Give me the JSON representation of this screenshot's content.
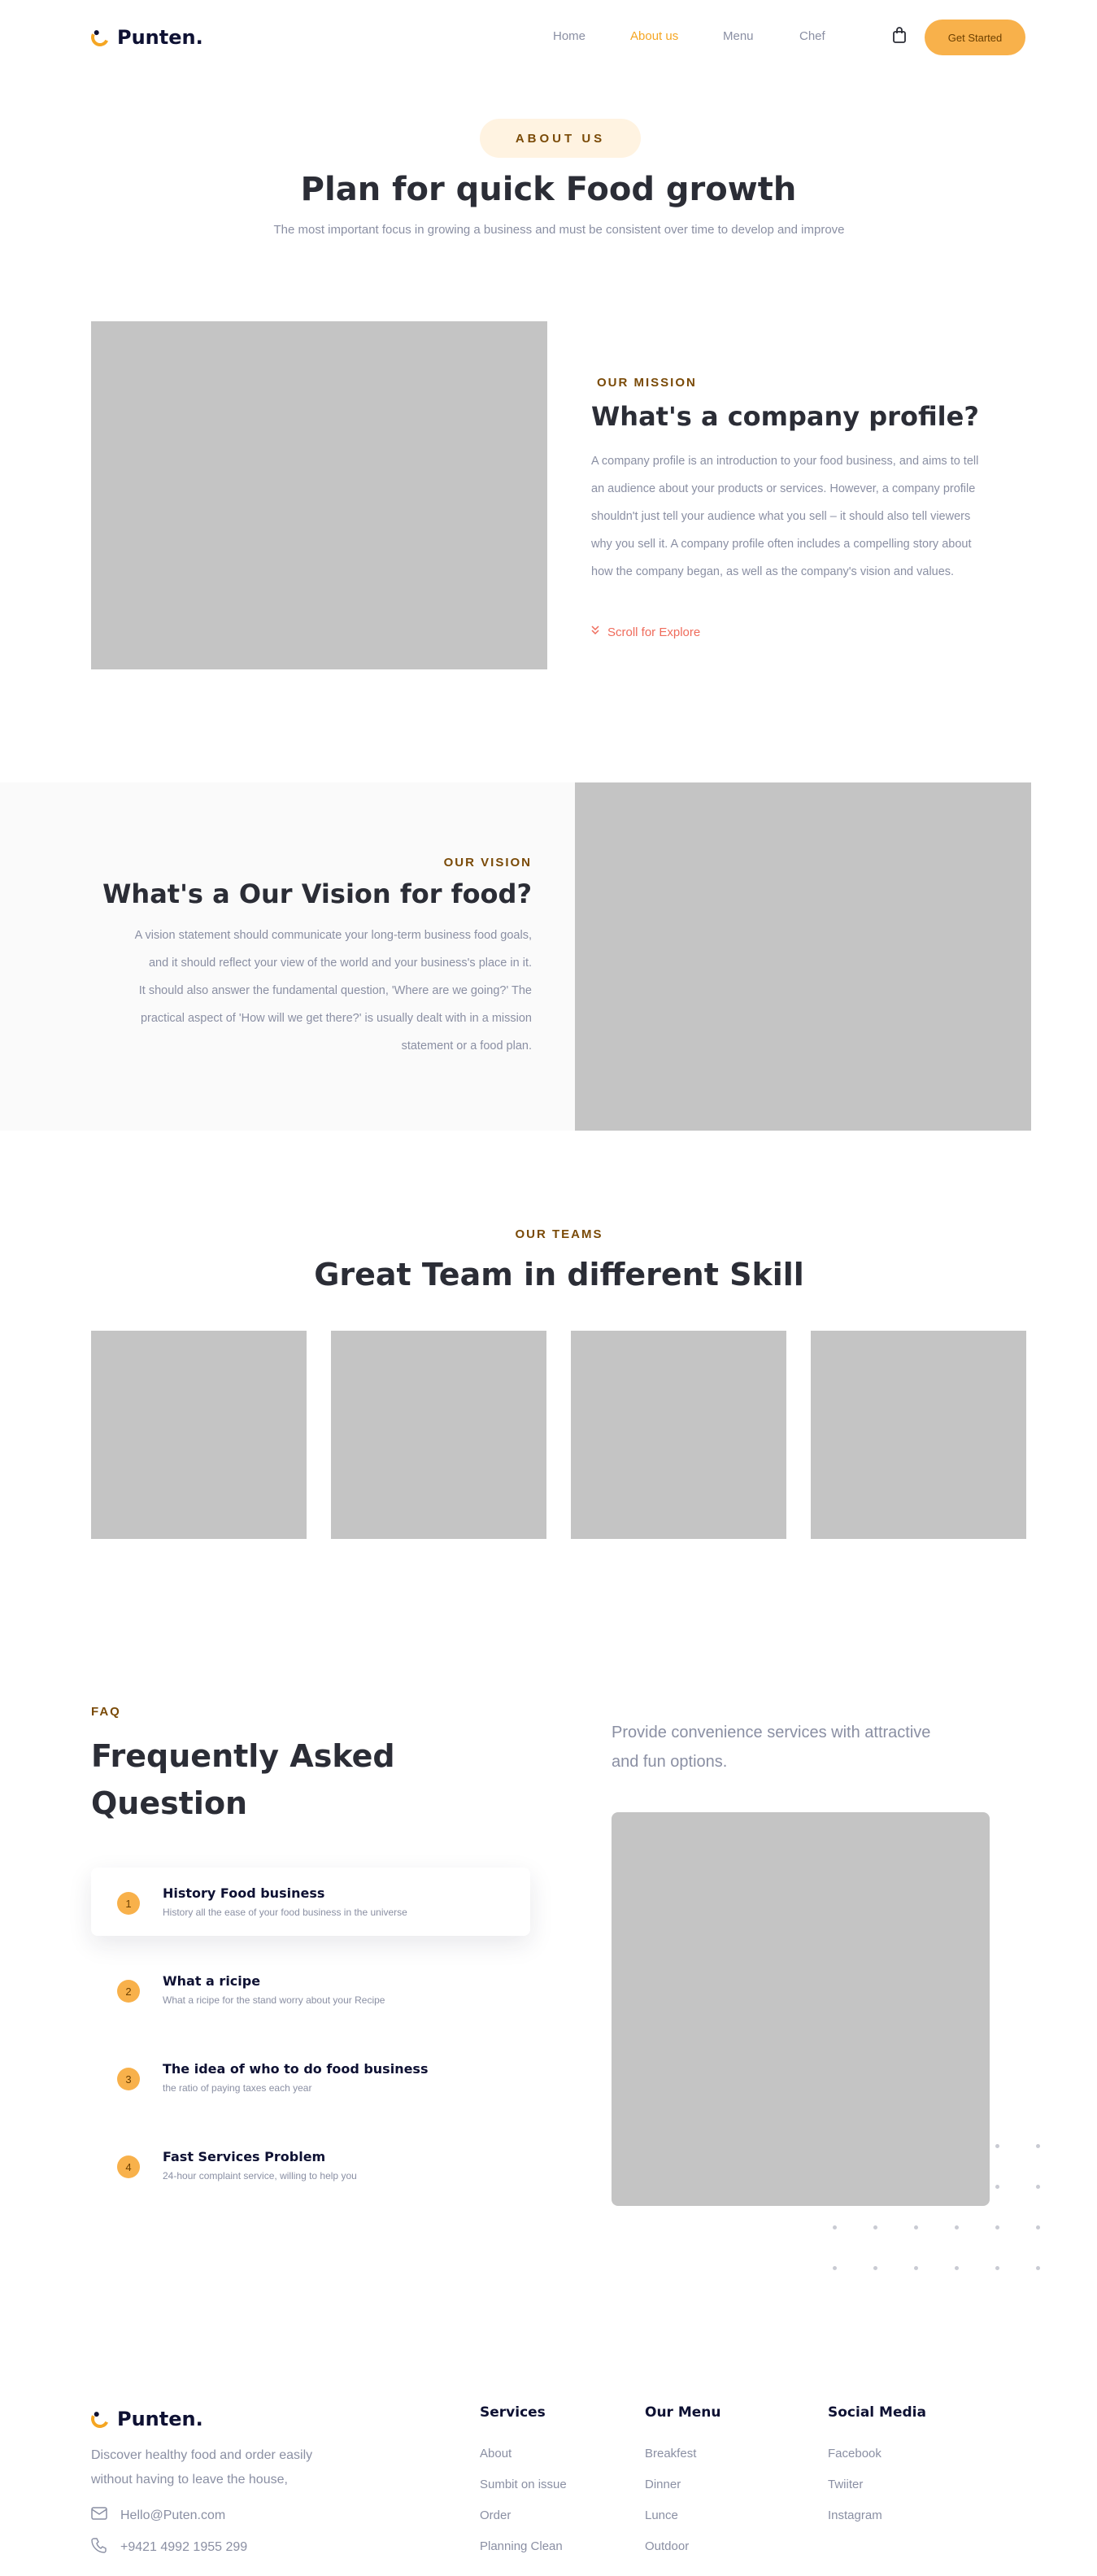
{
  "brand": {
    "name": "Punten."
  },
  "nav": {
    "items": [
      {
        "label": "Home",
        "active": false
      },
      {
        "label": "About us",
        "active": true
      },
      {
        "label": "Menu",
        "active": false
      },
      {
        "label": "Chef",
        "active": false
      }
    ],
    "cta": "Get Started"
  },
  "hero": {
    "pill": "ABOUT US",
    "title": "Plan for quick Food growth",
    "subtitle": "The most important focus in growing a business and must be consistent over time to develop and improve"
  },
  "mission": {
    "eyebrow": "OUR MISSION",
    "title": "What's a company profile?",
    "lines": [
      "A company profile is an introduction to your food business, and aims to tell",
      "an audience about your products or services. However, a company profile",
      "shouldn't just tell your audience what you sell – it should also tell viewers",
      "why you sell it. A company profile often includes a compelling story about",
      "how the company began, as well as the company's vision and values."
    ],
    "scroll": "Scroll for Explore"
  },
  "vision": {
    "eyebrow": "OUR VISION",
    "title": "What's a Our Vision for food?",
    "lines": [
      "A vision statement should communicate your long-term business food goals,",
      "and it should reflect your view of the world and your business's place in it.",
      "It should also answer the fundamental question, 'Where are we going?' The",
      "practical aspect of 'How will we get there?' is usually dealt with in a mission",
      "statement or a food plan."
    ]
  },
  "teams": {
    "eyebrow": "OUR TEAMS",
    "title": "Great Team in different Skill"
  },
  "faq": {
    "eyebrow": "FAQ",
    "title_line1": "Frequently Asked",
    "title_line2": "Question",
    "side_line1": "Provide convenience services with attractive",
    "side_line2": "and fun options.",
    "items": [
      {
        "num": "1",
        "title": "History Food business",
        "desc": "History all the ease of your food business in the universe"
      },
      {
        "num": "2",
        "title": "What a ricipe",
        "desc": "What a ricipe for the stand worry about your Recipe"
      },
      {
        "num": "3",
        "title": "The idea of who to do food business",
        "desc": "the ratio of paying taxes each year"
      },
      {
        "num": "4",
        "title": "Fast Services Problem",
        "desc": "24-hour complaint service, willing to help you"
      }
    ]
  },
  "footer": {
    "tagline_line1": "Discover healthy food and order easily",
    "tagline_line2": "without having to leave the house,",
    "email": "Hello@Puten.com",
    "phone": "+9421 4992 1955 299",
    "columns": [
      {
        "title": "Services",
        "links": [
          "About",
          "Sumbit on issue",
          "Order",
          "Planning Clean"
        ]
      },
      {
        "title": "Our Menu",
        "links": [
          "Breakfest",
          "Dinner",
          "Lunce",
          "Outdoor"
        ]
      },
      {
        "title": "Social Media",
        "links": [
          "Facebook",
          "Twiiter",
          "Instagram"
        ]
      }
    ]
  }
}
